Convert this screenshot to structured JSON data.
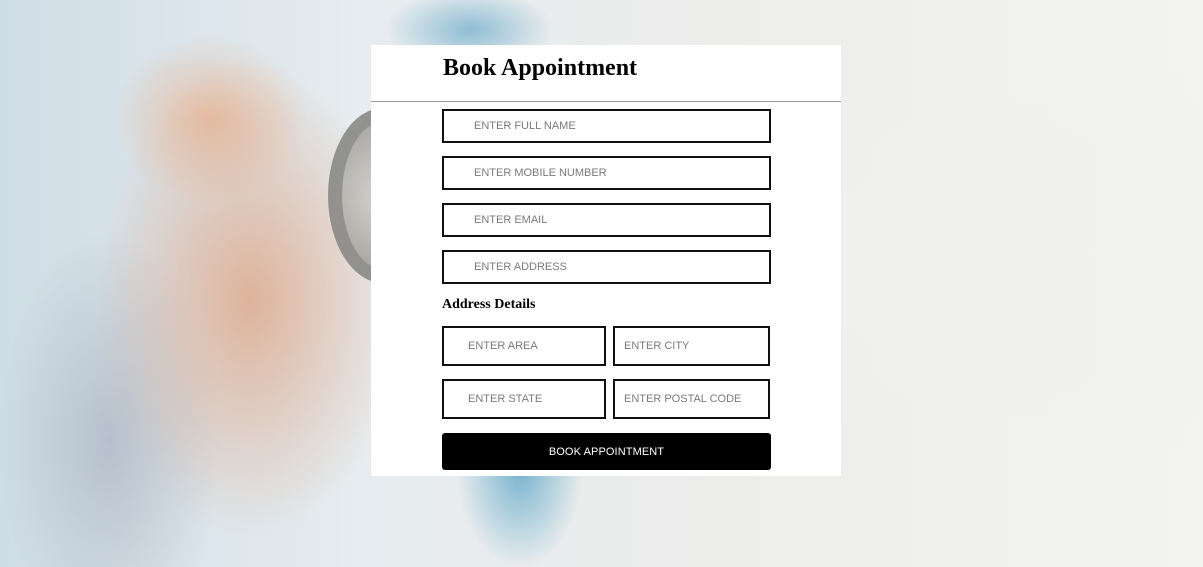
{
  "form": {
    "title": "Book Appointment",
    "fields": {
      "full_name": {
        "placeholder": "ENTER FULL NAME",
        "value": ""
      },
      "mobile": {
        "placeholder": "ENTER MOBILE NUMBER",
        "value": ""
      },
      "email": {
        "placeholder": "ENTER EMAIL",
        "value": ""
      },
      "address": {
        "placeholder": "ENTER ADDRESS",
        "value": ""
      }
    },
    "address_section": {
      "label": "Address Details",
      "area": {
        "placeholder": "ENTER AREA",
        "value": ""
      },
      "city": {
        "placeholder": "ENTER CITY",
        "value": ""
      },
      "state": {
        "placeholder": "ENTER STATE",
        "value": ""
      },
      "postal_code": {
        "placeholder": "ENTER POSTAL CODE",
        "value": ""
      }
    },
    "submit_label": "BOOK APPOINTMENT"
  },
  "colors": {
    "panel_bg": "#ffffff",
    "border": "#111111",
    "button_bg": "#000000",
    "button_text": "#ffffff"
  }
}
